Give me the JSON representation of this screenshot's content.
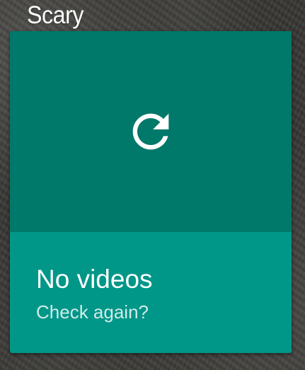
{
  "header": {
    "category_title": "Scary"
  },
  "card": {
    "title": "No videos",
    "subtitle": "Check again?",
    "icon": "refresh-icon",
    "colors": {
      "hero_background": "#00796b",
      "info_background": "#009688",
      "text": "#ffffff"
    }
  }
}
